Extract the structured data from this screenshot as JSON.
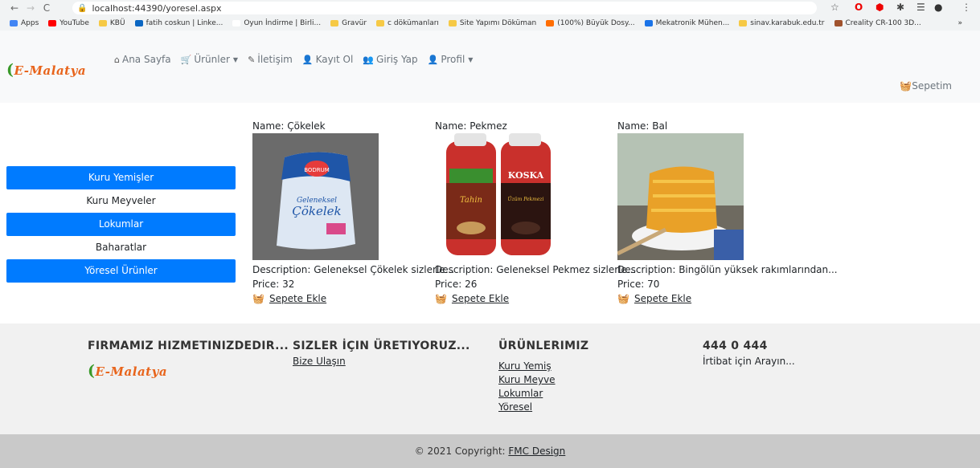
{
  "browser": {
    "url": "localhost:44390/yoresel.aspx",
    "bookmarks": [
      {
        "label": "Apps",
        "color": "#4285f4"
      },
      {
        "label": "YouTube",
        "color": "#ff0000"
      },
      {
        "label": "KBÜ",
        "color": "#f6c945"
      },
      {
        "label": "fatih coskun | Linke...",
        "color": "#0a66c2"
      },
      {
        "label": "Oyun İndirme | Birli...",
        "color": "#ffffff"
      },
      {
        "label": "Gravür",
        "color": "#f6c945"
      },
      {
        "label": "c dökümanları",
        "color": "#f6c945"
      },
      {
        "label": "Site Yapımı Döküman",
        "color": "#f6c945"
      },
      {
        "label": "(100%) Büyük Dosy...",
        "color": "#ff6d00"
      },
      {
        "label": "Mekatronik Mühen...",
        "color": "#1a73e8"
      },
      {
        "label": "sinav.karabuk.edu.tr",
        "color": "#f6c945"
      },
      {
        "label": "Creality CR-100 3D...",
        "color": "#a0522d"
      }
    ],
    "more": "»"
  },
  "site": {
    "logo": "E-Malatya",
    "nav": [
      {
        "label": "Ana Sayfa",
        "icon": "home-icon",
        "glyph": "⌂",
        "dropdown": false
      },
      {
        "label": "Ürünler",
        "icon": "cart-icon",
        "glyph": "🛒",
        "dropdown": true
      },
      {
        "label": "İletişim",
        "icon": "contact-icon",
        "glyph": "✎",
        "dropdown": false
      },
      {
        "label": "Kayıt Ol",
        "icon": "user-plus-icon",
        "glyph": "👤",
        "dropdown": false
      },
      {
        "label": "Giriş Yap",
        "icon": "users-icon",
        "glyph": "👥",
        "dropdown": false
      },
      {
        "label": "Profil",
        "icon": "user-icon",
        "glyph": "👤",
        "dropdown": true
      }
    ],
    "cart_label": "Sepetim"
  },
  "sidebar": [
    {
      "label": "Kuru Yemişler",
      "active": true
    },
    {
      "label": "Kuru Meyveler",
      "active": false
    },
    {
      "label": "Lokumlar",
      "active": true
    },
    {
      "label": "Baharatlar",
      "active": false
    },
    {
      "label": "Yöresel Ürünler",
      "active": true
    }
  ],
  "products": [
    {
      "name": "Name: Çökelek",
      "description": "Description: Geleneksel Çökelek sizlerle...",
      "price": "Price: 32",
      "add": "Sepete Ekle"
    },
    {
      "name": "Name: Pekmez",
      "description": "Description: Geleneksel Pekmez sizlerle...",
      "price": "Price: 26",
      "add": "Sepete Ekle"
    },
    {
      "name": "Name: Bal",
      "description": "Description: Bingölün yüksek rakımlarından...",
      "price": "Price: 70",
      "add": "Sepete Ekle"
    }
  ],
  "product_image_text": {
    "cokelek_brand": "BODRUM",
    "cokelek_line1": "Geleneksel",
    "cokelek_line2": "Çökelek",
    "pekmez_label1": "Tahin",
    "pekmez_brand": "KOSKA",
    "pekmez_label2": "Üzüm Pekmezi"
  },
  "footer": {
    "col1_title": "FIRMAMIZ HIZMETINIZDEDIR...",
    "col2_title": "SIZLER İÇIN ÜRETIYORUZ...",
    "col2_link": "Bize Ulaşın",
    "col3_title": "ÜRÜNLERIMIZ",
    "col3_links": [
      "Kuru Yemiş",
      "Kuru Meyve",
      "Lokumlar",
      "Yöresel"
    ],
    "col4_title": "444 0 444",
    "col4_text": "İrtibat için Arayın...",
    "copyright": "© 2021 Copyright: ",
    "copyright_link": "FMC Design"
  }
}
